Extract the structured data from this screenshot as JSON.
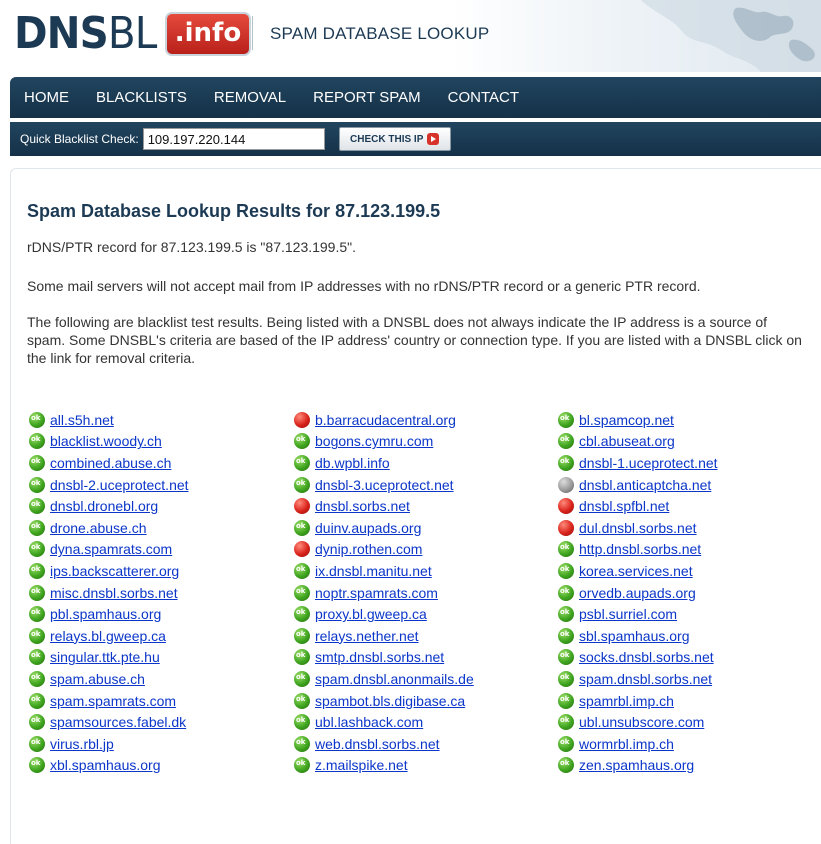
{
  "header": {
    "logo_dnsbl_bold": "DNS",
    "logo_dnsbl_light": "BL",
    "logo_info": ".info",
    "tagline": "SPAM DATABASE LOOKUP"
  },
  "nav": [
    "HOME",
    "BLACKLISTS",
    "REMOVAL",
    "REPORT SPAM",
    "CONTACT"
  ],
  "quick_check": {
    "label": "Quick Blacklist Check:",
    "value": "109.197.220.144",
    "button": "CHECK THIS IP"
  },
  "main": {
    "title": "Spam Database Lookup Results for 87.123.199.5",
    "rdns": "rDNS/PTR record for 87.123.199.5 is \"87.123.199.5\".",
    "note": "Some mail servers will not accept mail from IP addresses with no rDNS/PTR record or a generic PTR record.",
    "explanation": "The following are blacklist test results. Being listed with a DNSBL does not always indicate the IP address is a source of spam. Some DNSBL's criteria are based of the IP address' country or connection type. If you are listed with a DNSBL click on the link for removal criteria."
  },
  "colors": {
    "ok": "#3fa51f",
    "listed": "#d9231b",
    "unknown": "#9a9a9a",
    "link": "#0b36c9",
    "nav_bg": "#1a3a52"
  },
  "results": [
    {
      "name": "all.s5h.net",
      "status": "ok"
    },
    {
      "name": "b.barracudacentral.org",
      "status": "listed"
    },
    {
      "name": "bl.spamcop.net",
      "status": "ok"
    },
    {
      "name": "blacklist.woody.ch",
      "status": "ok"
    },
    {
      "name": "bogons.cymru.com",
      "status": "ok"
    },
    {
      "name": "cbl.abuseat.org",
      "status": "ok"
    },
    {
      "name": "combined.abuse.ch",
      "status": "ok"
    },
    {
      "name": "db.wpbl.info",
      "status": "ok"
    },
    {
      "name": "dnsbl-1.uceprotect.net",
      "status": "ok"
    },
    {
      "name": "dnsbl-2.uceprotect.net",
      "status": "ok"
    },
    {
      "name": "dnsbl-3.uceprotect.net",
      "status": "ok"
    },
    {
      "name": "dnsbl.anticaptcha.net",
      "status": "unknown"
    },
    {
      "name": "dnsbl.dronebl.org",
      "status": "ok"
    },
    {
      "name": "dnsbl.sorbs.net",
      "status": "listed"
    },
    {
      "name": "dnsbl.spfbl.net",
      "status": "listed"
    },
    {
      "name": "drone.abuse.ch",
      "status": "ok"
    },
    {
      "name": "duinv.aupads.org",
      "status": "ok"
    },
    {
      "name": "dul.dnsbl.sorbs.net",
      "status": "listed"
    },
    {
      "name": "dyna.spamrats.com",
      "status": "ok"
    },
    {
      "name": "dynip.rothen.com",
      "status": "listed"
    },
    {
      "name": "http.dnsbl.sorbs.net",
      "status": "ok"
    },
    {
      "name": "ips.backscatterer.org",
      "status": "ok"
    },
    {
      "name": "ix.dnsbl.manitu.net",
      "status": "ok"
    },
    {
      "name": "korea.services.net",
      "status": "ok"
    },
    {
      "name": "misc.dnsbl.sorbs.net",
      "status": "ok"
    },
    {
      "name": "noptr.spamrats.com",
      "status": "ok"
    },
    {
      "name": "orvedb.aupads.org",
      "status": "ok"
    },
    {
      "name": "pbl.spamhaus.org",
      "status": "ok"
    },
    {
      "name": "proxy.bl.gweep.ca",
      "status": "ok"
    },
    {
      "name": "psbl.surriel.com",
      "status": "ok"
    },
    {
      "name": "relays.bl.gweep.ca",
      "status": "ok"
    },
    {
      "name": "relays.nether.net",
      "status": "ok"
    },
    {
      "name": "sbl.spamhaus.org",
      "status": "ok"
    },
    {
      "name": "singular.ttk.pte.hu",
      "status": "ok"
    },
    {
      "name": "smtp.dnsbl.sorbs.net",
      "status": "ok"
    },
    {
      "name": "socks.dnsbl.sorbs.net",
      "status": "ok"
    },
    {
      "name": "spam.abuse.ch",
      "status": "ok"
    },
    {
      "name": "spam.dnsbl.anonmails.de",
      "status": "ok"
    },
    {
      "name": "spam.dnsbl.sorbs.net",
      "status": "ok"
    },
    {
      "name": "spam.spamrats.com",
      "status": "ok"
    },
    {
      "name": "spambot.bls.digibase.ca",
      "status": "ok"
    },
    {
      "name": "spamrbl.imp.ch",
      "status": "ok"
    },
    {
      "name": "spamsources.fabel.dk",
      "status": "ok"
    },
    {
      "name": "ubl.lashback.com",
      "status": "ok"
    },
    {
      "name": "ubl.unsubscore.com",
      "status": "ok"
    },
    {
      "name": "virus.rbl.jp",
      "status": "ok"
    },
    {
      "name": "web.dnsbl.sorbs.net",
      "status": "ok"
    },
    {
      "name": "wormrbl.imp.ch",
      "status": "ok"
    },
    {
      "name": "xbl.spamhaus.org",
      "status": "ok"
    },
    {
      "name": "z.mailspike.net",
      "status": "ok"
    },
    {
      "name": "zen.spamhaus.org",
      "status": "ok"
    }
  ]
}
